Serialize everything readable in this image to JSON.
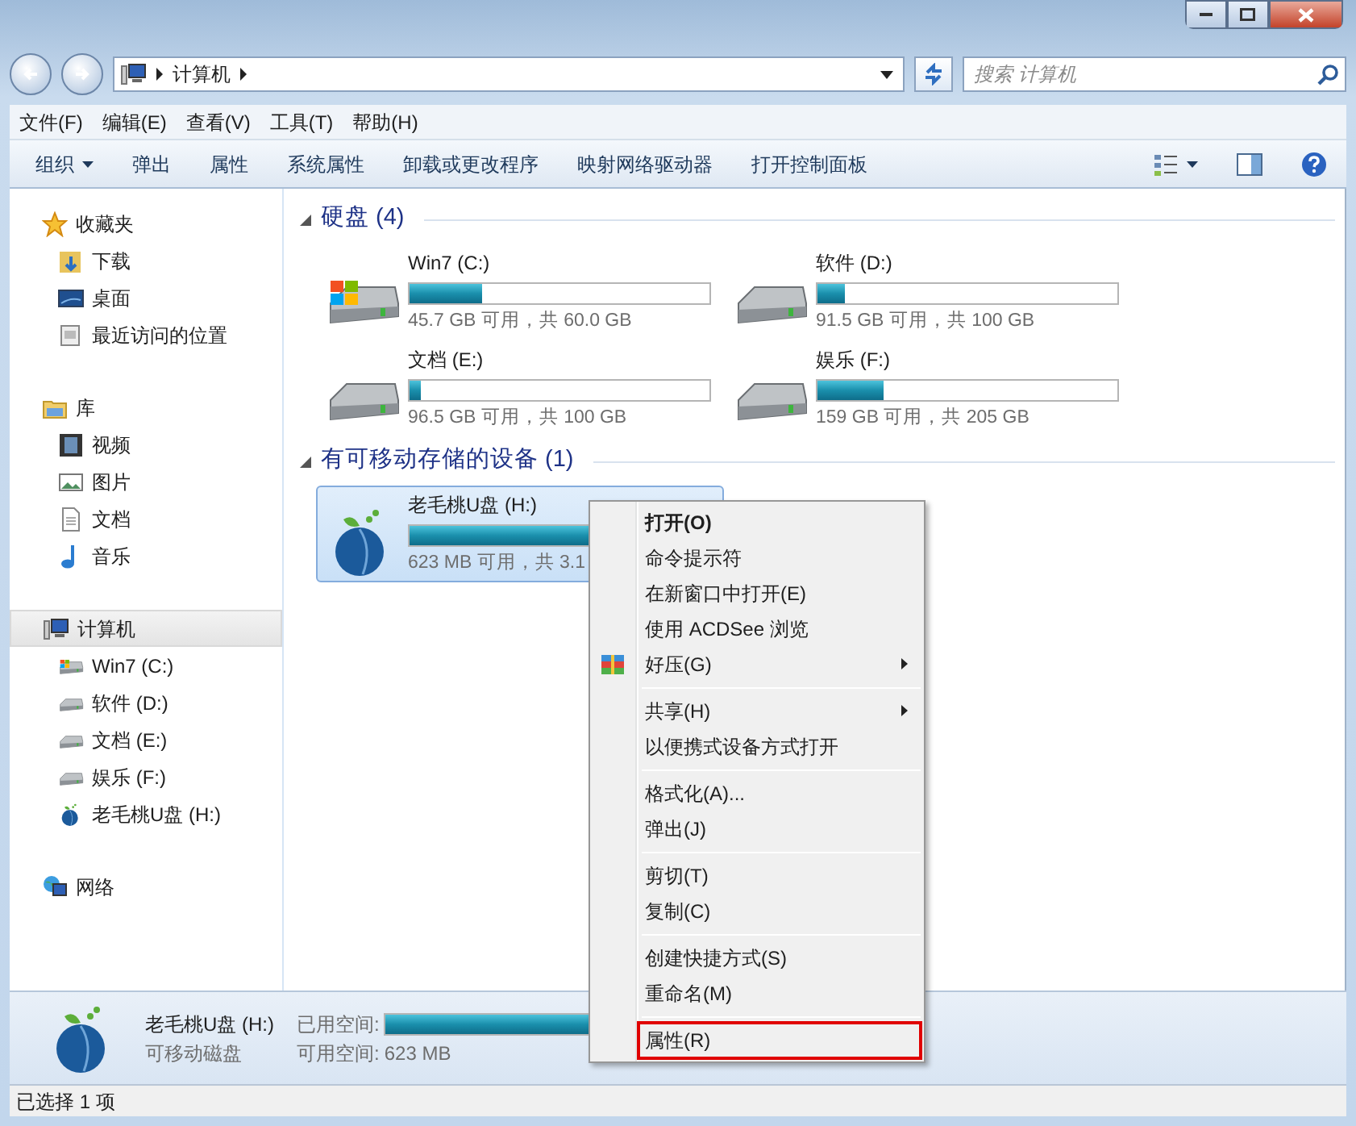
{
  "address_bar": {
    "path": [
      "计算机"
    ],
    "search": {
      "placeholder": "搜索 计算机"
    }
  },
  "menu_bar": [
    "文件(F)",
    "编辑(E)",
    "查看(V)",
    "工具(T)",
    "帮助(H)"
  ],
  "command_bar": {
    "items": [
      {
        "label": "组织",
        "dropdown": true
      },
      {
        "label": "弹出",
        "dropdown": false
      },
      {
        "label": "属性",
        "dropdown": false
      },
      {
        "label": "系统属性",
        "dropdown": false
      },
      {
        "label": "卸载或更改程序",
        "dropdown": false
      },
      {
        "label": "映射网络驱动器",
        "dropdown": false
      },
      {
        "label": "打开控制面板",
        "dropdown": false
      }
    ]
  },
  "sidebar": {
    "items": [
      {
        "label": "收藏夹",
        "kind": "star",
        "selected": false,
        "children": [
          {
            "label": "下载",
            "kind": "download",
            "selected": false
          },
          {
            "label": "桌面",
            "kind": "desktop",
            "selected": false
          },
          {
            "label": "最近访问的位置",
            "kind": "recent",
            "selected": false
          }
        ]
      },
      {
        "label": "库",
        "kind": "library",
        "selected": false,
        "children": [
          {
            "label": "视频",
            "kind": "video",
            "selected": false
          },
          {
            "label": "图片",
            "kind": "picture",
            "selected": false
          },
          {
            "label": "文档",
            "kind": "document",
            "selected": false
          },
          {
            "label": "音乐",
            "kind": "music",
            "selected": false
          }
        ]
      },
      {
        "label": "计算机",
        "kind": "computer",
        "selected": true,
        "children": [
          {
            "label": "Win7 (C:)",
            "kind": "windrive",
            "selected": false
          },
          {
            "label": "软件 (D:)",
            "kind": "drive",
            "selected": false
          },
          {
            "label": "文档 (E:)",
            "kind": "drive",
            "selected": false
          },
          {
            "label": "娱乐 (F:)",
            "kind": "drive",
            "selected": false
          },
          {
            "label": "老毛桃U盘 (H:)",
            "kind": "peach",
            "selected": false
          }
        ]
      },
      {
        "label": "网络",
        "kind": "network",
        "selected": false
      }
    ]
  },
  "sections": [
    {
      "title": "硬盘 (4)",
      "expanded": true,
      "drives": [
        {
          "name": "Win7 (C:)",
          "kind": "windrive",
          "level": 0.24,
          "space": "45.7 GB 可用，共 60.0 GB",
          "selected": false
        },
        {
          "name": "软件 (D:)",
          "kind": "drive",
          "level": 0.09,
          "space": "91.5 GB 可用，共 100 GB",
          "selected": false
        },
        {
          "name": "文档 (E:)",
          "kind": "drive",
          "level": 0.04,
          "space": "96.5 GB 可用，共 100 GB",
          "selected": false
        },
        {
          "name": "娱乐 (F:)",
          "kind": "drive",
          "level": 0.22,
          "space": "159 GB 可用，共 205 GB",
          "selected": false
        }
      ]
    },
    {
      "title": "有可移动存储的设备 (1)",
      "expanded": true,
      "drives": [
        {
          "name": "老毛桃U盘 (H:)",
          "kind": "peach",
          "level": 0.8,
          "space": "623 MB 可用，共 3.1",
          "selected": true
        }
      ]
    }
  ],
  "context_menu": {
    "groups": [
      [
        {
          "label": "打开(O)",
          "bold": true,
          "kind": "plain",
          "submenu": false,
          "highlighted": false
        },
        {
          "label": "命令提示符",
          "bold": false,
          "kind": "plain",
          "submenu": false,
          "highlighted": false
        },
        {
          "label": "在新窗口中打开(E)",
          "bold": false,
          "kind": "plain",
          "submenu": false,
          "highlighted": false
        },
        {
          "label": "使用 ACDSee 浏览",
          "bold": false,
          "kind": "plain",
          "submenu": false,
          "highlighted": false
        },
        {
          "label": "好压(G)",
          "bold": false,
          "kind": "archive",
          "submenu": true,
          "highlighted": false
        }
      ],
      [
        {
          "label": "共享(H)",
          "bold": false,
          "kind": "plain",
          "submenu": true,
          "highlighted": false
        },
        {
          "label": "以便携式设备方式打开",
          "bold": false,
          "kind": "plain",
          "submenu": false,
          "highlighted": false
        }
      ],
      [
        {
          "label": "格式化(A)...",
          "bold": false,
          "kind": "plain",
          "submenu": false,
          "highlighted": false
        },
        {
          "label": "弹出(J)",
          "bold": false,
          "kind": "plain",
          "submenu": false,
          "highlighted": false
        }
      ],
      [
        {
          "label": "剪切(T)",
          "bold": false,
          "kind": "plain",
          "submenu": false,
          "highlighted": false
        },
        {
          "label": "复制(C)",
          "bold": false,
          "kind": "plain",
          "submenu": false,
          "highlighted": false
        }
      ],
      [
        {
          "label": "创建快捷方式(S)",
          "bold": false,
          "kind": "plain",
          "submenu": false,
          "highlighted": false
        },
        {
          "label": "重命名(M)",
          "bold": false,
          "kind": "plain",
          "submenu": false,
          "highlighted": false
        }
      ],
      [
        {
          "label": "属性(R)",
          "bold": false,
          "kind": "plain",
          "submenu": false,
          "highlighted": true
        }
      ]
    ]
  },
  "details_pane": {
    "name": "老毛桃U盘 (H:)",
    "kind": "peach",
    "type": "可移动磁盘",
    "used_label": "已用空间:",
    "level": 0.8,
    "free_label": "可用空间:",
    "free": "623 MB"
  },
  "status_bar": {
    "text": "已选择 1 项"
  }
}
